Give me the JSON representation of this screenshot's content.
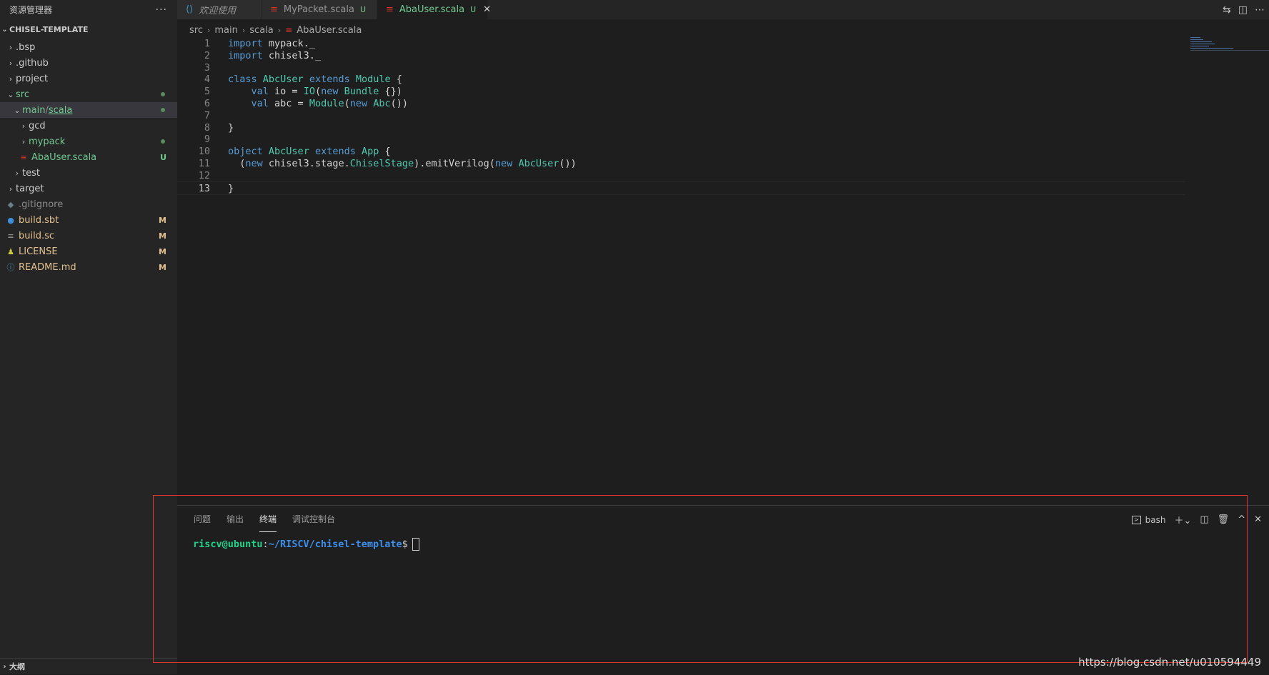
{
  "sidebar": {
    "title": "资源管理器",
    "more": "···",
    "section": "CHISEL-TEMPLATE",
    "items": [
      {
        "label": ".bsp",
        "indent": 0,
        "type": "folder",
        "open": false,
        "color": "#cccccc"
      },
      {
        "label": ".github",
        "indent": 0,
        "type": "folder",
        "open": false,
        "color": "#cccccc"
      },
      {
        "label": "project",
        "indent": 0,
        "type": "folder",
        "open": false,
        "color": "#cccccc"
      },
      {
        "label": "src",
        "indent": 0,
        "type": "folder",
        "open": true,
        "color": "#73c991",
        "dot": true
      },
      {
        "label": "main",
        "indent": 1,
        "type": "folder",
        "open": true,
        "color": "#73c991",
        "dot": true,
        "selected": true,
        "suffix": "scala"
      },
      {
        "label": "gcd",
        "indent": 2,
        "type": "folder",
        "open": false,
        "color": "#cccccc"
      },
      {
        "label": "mypack",
        "indent": 2,
        "type": "folder",
        "open": false,
        "color": "#73c991",
        "dot": true
      },
      {
        "label": "AbaUser.scala",
        "indent": 2,
        "type": "file",
        "icon": "≡",
        "iconColor": "#d8322c",
        "color": "#73c991",
        "badge": "U"
      },
      {
        "label": "test",
        "indent": 1,
        "type": "folder",
        "open": false,
        "color": "#cccccc"
      },
      {
        "label": "target",
        "indent": 0,
        "type": "folder",
        "open": false,
        "color": "#cccccc"
      },
      {
        "label": ".gitignore",
        "indent": 0,
        "type": "file",
        "icon": "◆",
        "iconColor": "#6d8086",
        "color": "#8c8c8c"
      },
      {
        "label": "build.sbt",
        "indent": 0,
        "type": "file",
        "icon": "●",
        "iconColor": "#3c8fd6",
        "color": "#e2c08d",
        "badge": "M"
      },
      {
        "label": "build.sc",
        "indent": 0,
        "type": "file",
        "icon": "≡",
        "iconColor": "#9d9d9d",
        "color": "#e2c08d",
        "badge": "M"
      },
      {
        "label": "LICENSE",
        "indent": 0,
        "type": "file",
        "icon": "♟",
        "iconColor": "#cbcb41",
        "color": "#e2c08d",
        "badge": "M"
      },
      {
        "label": "README.md",
        "indent": 0,
        "type": "file",
        "icon": "ⓘ",
        "iconColor": "#519aba",
        "color": "#e2c08d",
        "badge": "M"
      }
    ],
    "outline": "大纲"
  },
  "tabs": [
    {
      "label": "欢迎使用",
      "icon": "vscode-icon"
    },
    {
      "label": "MyPacket.scala",
      "mod": "U",
      "icon": "scala-icon"
    },
    {
      "label": "AbaUser.scala",
      "mod": "U",
      "icon": "scala-icon",
      "active": true,
      "close": "✕"
    }
  ],
  "breadcrumb": [
    "src",
    "main",
    "scala",
    "AbaUser.scala"
  ],
  "editor": {
    "lines": [
      {
        "n": "1",
        "tokens": [
          [
            "kw",
            "import"
          ],
          [
            "pl",
            " mypack._"
          ]
        ]
      },
      {
        "n": "2",
        "tokens": [
          [
            "kw",
            "import"
          ],
          [
            "pl",
            " chisel3._"
          ]
        ]
      },
      {
        "n": "3",
        "tokens": []
      },
      {
        "n": "4",
        "tokens": [
          [
            "kw",
            "class"
          ],
          [
            "pl",
            " "
          ],
          [
            "ty",
            "AbcUser"
          ],
          [
            "pl",
            " "
          ],
          [
            "kw",
            "extends"
          ],
          [
            "pl",
            " "
          ],
          [
            "ty",
            "Module"
          ],
          [
            "pl",
            " {"
          ]
        ]
      },
      {
        "n": "5",
        "tokens": [
          [
            "pl",
            "    "
          ],
          [
            "kw",
            "val"
          ],
          [
            "pl",
            " io = "
          ],
          [
            "ty",
            "IO"
          ],
          [
            "pl",
            "("
          ],
          [
            "kw",
            "new"
          ],
          [
            "pl",
            " "
          ],
          [
            "ty",
            "Bundle"
          ],
          [
            "pl",
            " {})"
          ]
        ]
      },
      {
        "n": "6",
        "tokens": [
          [
            "pl",
            "    "
          ],
          [
            "kw",
            "val"
          ],
          [
            "pl",
            " abc = "
          ],
          [
            "ty",
            "Module"
          ],
          [
            "pl",
            "("
          ],
          [
            "kw",
            "new"
          ],
          [
            "pl",
            " "
          ],
          [
            "ty",
            "Abc"
          ],
          [
            "pl",
            "())"
          ]
        ]
      },
      {
        "n": "7",
        "tokens": []
      },
      {
        "n": "8",
        "tokens": [
          [
            "pl",
            "}"
          ]
        ]
      },
      {
        "n": "9",
        "tokens": []
      },
      {
        "n": "10",
        "tokens": [
          [
            "kw",
            "object"
          ],
          [
            "pl",
            " "
          ],
          [
            "ty",
            "AbcUser"
          ],
          [
            "pl",
            " "
          ],
          [
            "kw",
            "extends"
          ],
          [
            "pl",
            " "
          ],
          [
            "ty",
            "App"
          ],
          [
            "pl",
            " {"
          ]
        ]
      },
      {
        "n": "11",
        "tokens": [
          [
            "pl",
            "  ("
          ],
          [
            "kw",
            "new"
          ],
          [
            "pl",
            " chisel3.stage."
          ],
          [
            "ty",
            "ChiselStage"
          ],
          [
            "pl",
            ").emitVerilog("
          ],
          [
            "kw",
            "new"
          ],
          [
            "pl",
            " "
          ],
          [
            "ty",
            "AbcUser"
          ],
          [
            "pl",
            "())"
          ]
        ]
      },
      {
        "n": "12",
        "tokens": []
      },
      {
        "n": "13",
        "tokens": [
          [
            "pl",
            "}"
          ]
        ],
        "current": true
      }
    ]
  },
  "panel": {
    "tabs": [
      {
        "label": "问题"
      },
      {
        "label": "输出"
      },
      {
        "label": "终端",
        "active": true
      },
      {
        "label": "调试控制台"
      }
    ],
    "terminal_name": "bash",
    "prompt_user": "riscv@ubuntu",
    "prompt_sep": ":",
    "prompt_path": "~/RISCV/chisel-template",
    "prompt_end": "$"
  },
  "watermark": "https://blog.csdn.net/u010594449"
}
